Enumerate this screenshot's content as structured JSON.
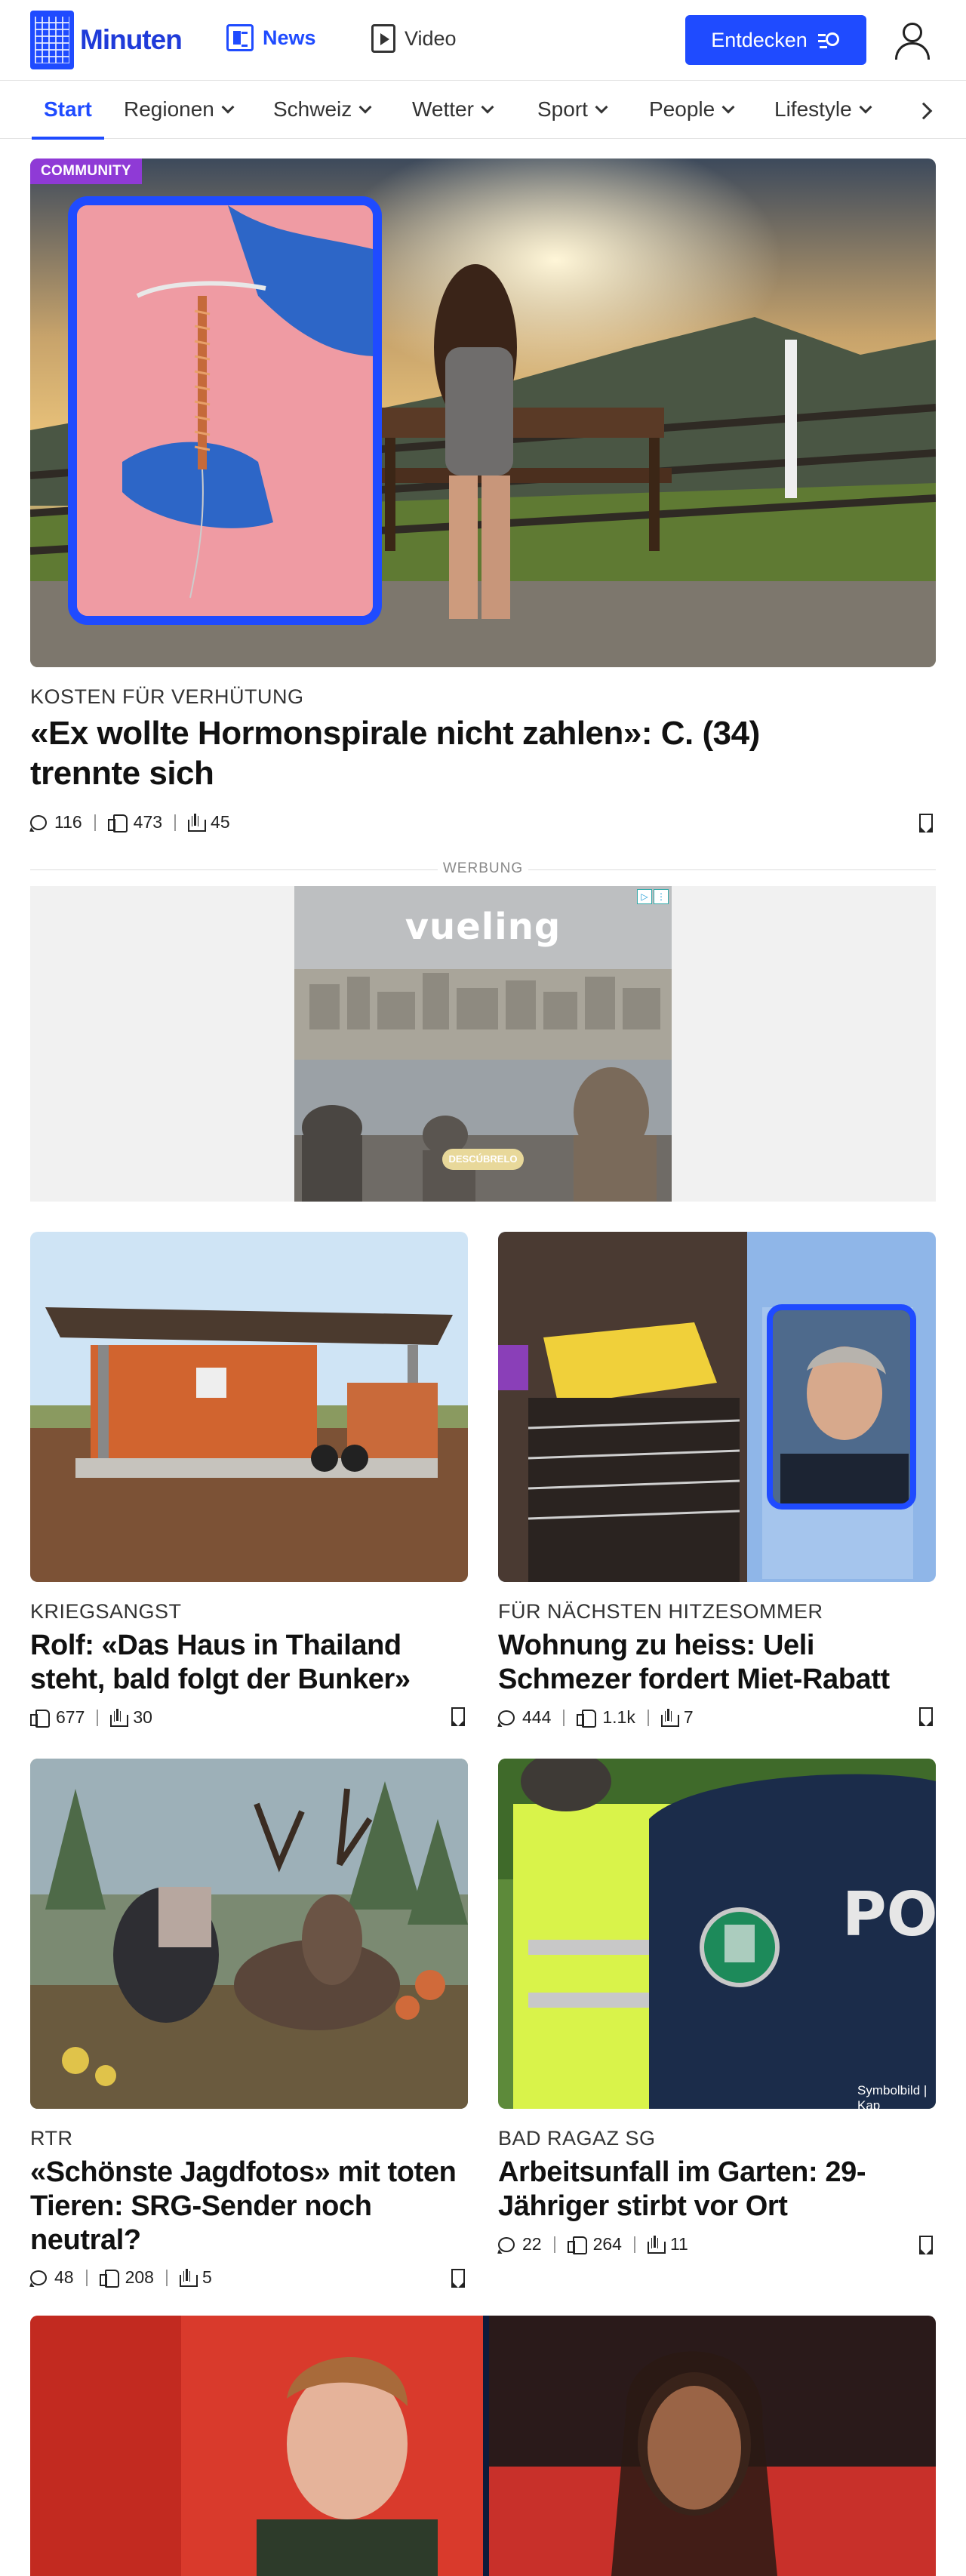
{
  "header": {
    "logo_text": "Minuten",
    "nav": [
      {
        "label": "News",
        "icon": "news-icon",
        "active": true
      },
      {
        "label": "Video",
        "icon": "video-icon",
        "active": false
      }
    ],
    "discover_button": "Entdecken",
    "accent_color": "#1f4bff"
  },
  "categories": [
    {
      "label": "Start",
      "active": true,
      "dropdown": false
    },
    {
      "label": "Regionen",
      "dropdown": true
    },
    {
      "label": "Schweiz",
      "dropdown": true
    },
    {
      "label": "Wetter",
      "dropdown": true
    },
    {
      "label": "Sport",
      "dropdown": true
    },
    {
      "label": "People",
      "dropdown": true
    },
    {
      "label": "Lifestyle",
      "dropdown": true
    }
  ],
  "hero": {
    "badge": "COMMUNITY",
    "kicker": "Kosten für Verhütung",
    "title": "«Ex wollte Hormonspirale nicht zahlen»: C. (34) trennte sich",
    "comments": "116",
    "likes": "473",
    "shares": "45"
  },
  "ad": {
    "label": "WERBUNG",
    "brand": "vueling",
    "cta": "DESCÚBRELO"
  },
  "articles": [
    {
      "kicker": "Kriegsangst",
      "title": "Rolf: «Das Haus in Thailand steht, bald folgt der Bunker»",
      "likes": "677",
      "shares": "30"
    },
    {
      "kicker": "Für nächsten Hitzesommer",
      "title": "Wohnung zu heiss: Ueli Schmezer fordert Miet-Rabatt",
      "comments": "444",
      "likes": "1.1k",
      "shares": "7"
    },
    {
      "kicker": "RTR",
      "title": "«Schönste Jagdfotos» mit toten Tieren: SRG-Sender noch neutral?",
      "comments": "48",
      "likes": "208",
      "shares": "5"
    },
    {
      "kicker": "Bad Ragaz SG",
      "title": "Arbeitsunfall im Garten: 29-Jähriger stirbt vor Ort",
      "comments": "22",
      "likes": "264",
      "shares": "11",
      "image_caption": "Symbolbild | Kap"
    }
  ]
}
